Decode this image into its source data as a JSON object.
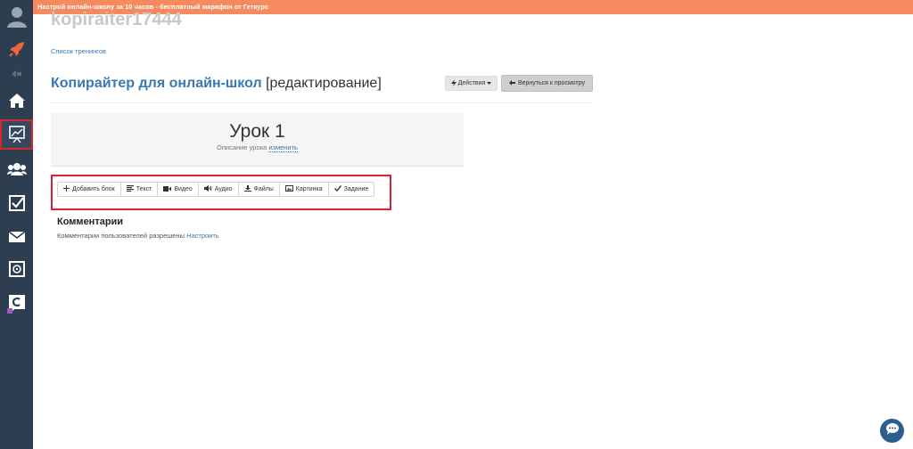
{
  "banner": {
    "text": "Настрой онлайн-школу за 10 часов - бесплатный марафон от Геткурс"
  },
  "header": {
    "username": "kopiraiter17444",
    "breadcrumb": "Список тренингов"
  },
  "page": {
    "title": "Копирайтер для онлайн-школ",
    "title_suffix": "[редактирование]",
    "actions_label": "Действия",
    "back_label": "Вернуться к просмотру"
  },
  "lesson": {
    "title": "Урок 1",
    "desc_label": "Описание урока",
    "edit_link": "изменить"
  },
  "toolbar": {
    "items": [
      {
        "label": "Добавить блок",
        "icon": "plus-icon"
      },
      {
        "label": "Текст",
        "icon": "text-lines-icon"
      },
      {
        "label": "Видео",
        "icon": "video-camera-icon"
      },
      {
        "label": "Аудио",
        "icon": "volume-icon"
      },
      {
        "label": "Файлы",
        "icon": "download-icon"
      },
      {
        "label": "Картинка",
        "icon": "picture-icon"
      },
      {
        "label": "Задание",
        "icon": "check-icon"
      }
    ]
  },
  "comments": {
    "heading": "Комментарии",
    "text": "Комментарии пользователей разрешены",
    "link": "Настроить"
  },
  "colors": {
    "sidebar": "#2c3e50",
    "banner": "#f58a5e",
    "link": "#3a79b0",
    "highlight": "#d9262e"
  },
  "sidebar": {
    "items": [
      {
        "icon": "user-avatar-icon"
      },
      {
        "icon": "rocket-icon"
      },
      {
        "icon": "collapse-arrow-icon"
      },
      {
        "icon": "home-icon"
      },
      {
        "icon": "training-board-icon"
      },
      {
        "icon": "users-icon"
      },
      {
        "icon": "checkbox-icon"
      },
      {
        "icon": "envelope-icon"
      },
      {
        "icon": "safe-icon"
      },
      {
        "icon": "getcourse-logo-icon"
      }
    ]
  }
}
